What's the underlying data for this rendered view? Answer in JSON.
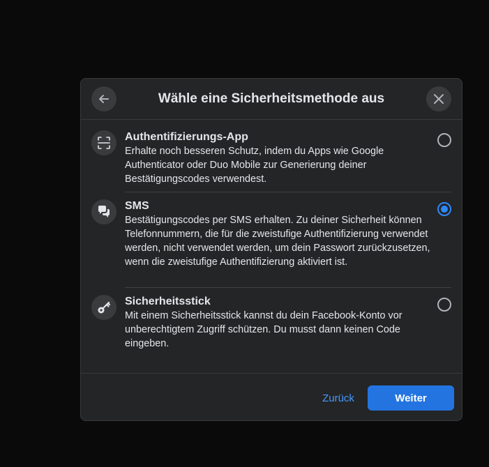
{
  "dialog": {
    "title": "Wähle eine Sicherheitsmethode aus",
    "back_icon": "arrow-left-icon",
    "close_icon": "close-icon"
  },
  "options": [
    {
      "icon": "qr-scan-icon",
      "title": "Authentifizierungs-App",
      "description": "Erhalte noch besseren Schutz, indem du Apps wie Google Authenticator oder Duo Mobile zur Generierung deiner Bestätigungscodes verwendest.",
      "selected": false
    },
    {
      "icon": "chat-bubbles-icon",
      "title": "SMS",
      "description": "Bestätigungscodes per SMS erhalten. Zu deiner Sicherheit können Telefonnummern, die für die zweistufige Authentifizierung verwendet werden, nicht verwendet werden, um dein Passwort zurückzusetzen, wenn die zweistufige Authentifizierung aktiviert ist.",
      "selected": true
    },
    {
      "icon": "key-icon",
      "title": "Sicherheitsstick",
      "description": "Mit einem Sicherheitsstick kannst du dein Facebook-Konto vor unberechtigtem Zugriff schützen. Du musst dann keinen Code eingeben.",
      "selected": false
    }
  ],
  "footer": {
    "back_label": "Zurück",
    "next_label": "Weiter"
  },
  "colors": {
    "accent": "#2374e1",
    "radio_selected": "#2d88ff",
    "link": "#4599ff",
    "dialog_bg": "#242526"
  }
}
